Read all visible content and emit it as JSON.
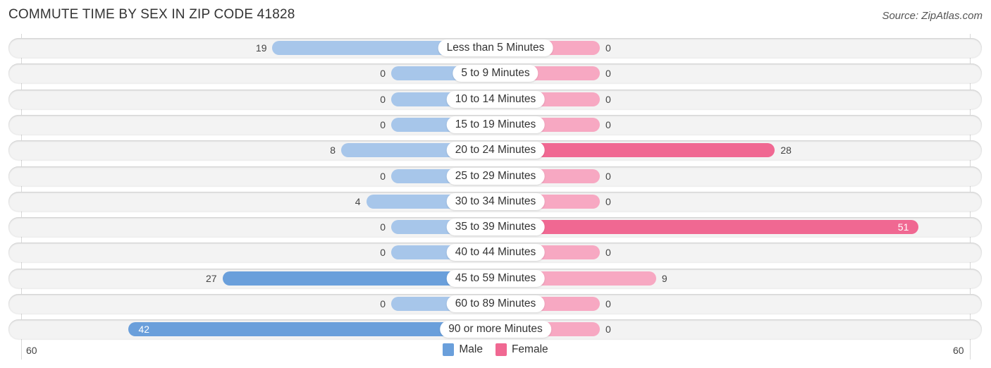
{
  "header": {
    "title": "COMMUTE TIME BY SEX IN ZIP CODE 41828",
    "source": "Source: ZipAtlas.com"
  },
  "colors": {
    "male": "#a7c6ea",
    "male_strong": "#6a9fdb",
    "female": "#f7a8c2",
    "female_strong": "#f06892",
    "legend_male": "#6a9fdb",
    "legend_female": "#f06892"
  },
  "chart_data": {
    "type": "bar",
    "orientation": "horizontal-diverging",
    "title": "COMMUTE TIME BY SEX IN ZIP CODE 41828",
    "categories": [
      "Less than 5 Minutes",
      "5 to 9 Minutes",
      "10 to 14 Minutes",
      "15 to 19 Minutes",
      "20 to 24 Minutes",
      "25 to 29 Minutes",
      "30 to 34 Minutes",
      "35 to 39 Minutes",
      "40 to 44 Minutes",
      "45 to 59 Minutes",
      "60 to 89 Minutes",
      "90 or more Minutes"
    ],
    "series": [
      {
        "name": "Male",
        "values": [
          19,
          0,
          0,
          0,
          8,
          0,
          4,
          0,
          0,
          27,
          0,
          42
        ]
      },
      {
        "name": "Female",
        "values": [
          0,
          0,
          0,
          0,
          28,
          0,
          0,
          51,
          0,
          9,
          0,
          0
        ]
      }
    ],
    "axis": {
      "left_max": 60,
      "right_max": 60,
      "left_label": "60",
      "right_label": "60"
    },
    "legend": {
      "position": "bottom-center",
      "entries": [
        "Male",
        "Female"
      ]
    },
    "grid": false
  }
}
